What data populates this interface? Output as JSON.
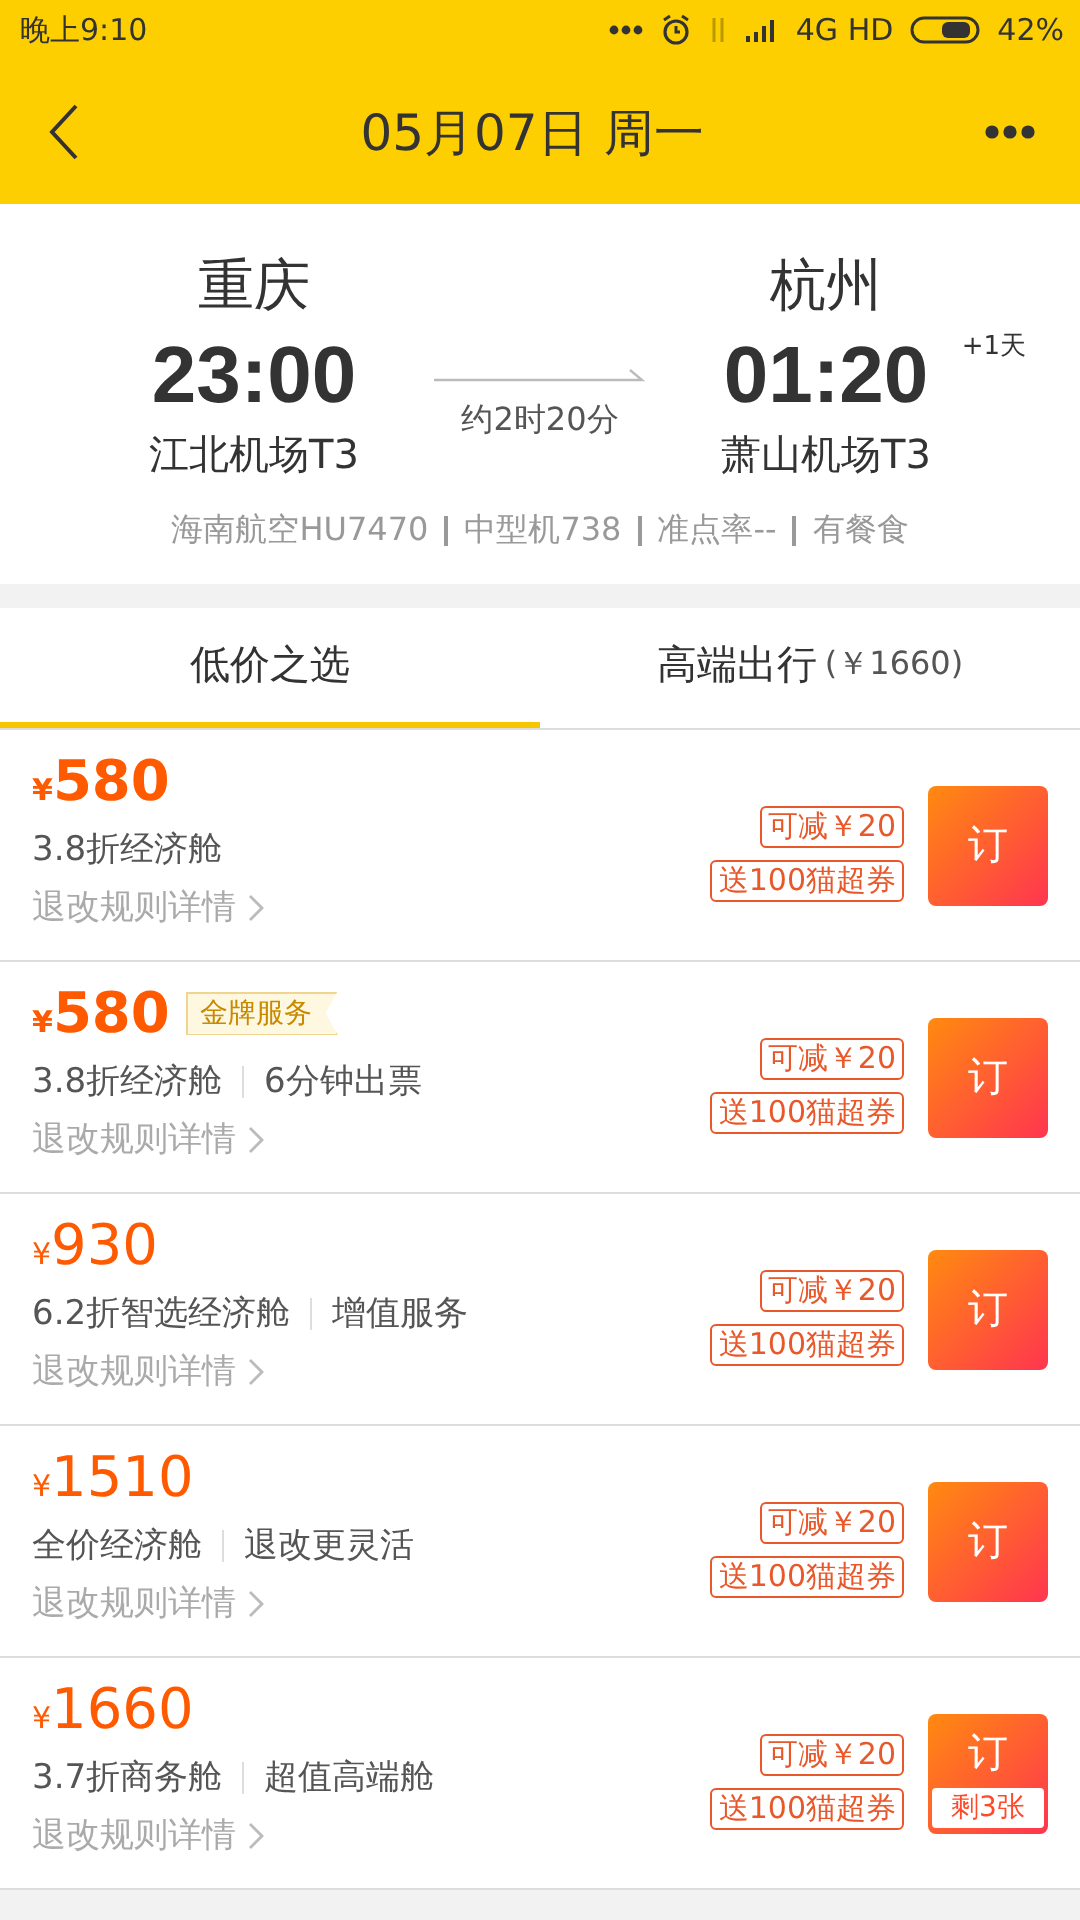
{
  "status_bar": {
    "time": "晚上9:10",
    "network": "4G HD",
    "battery": "42%"
  },
  "header": {
    "title": "05月07日 周一"
  },
  "flight": {
    "from_city": "重庆",
    "to_city": "杭州",
    "depart_time": "23:00",
    "arrive_time": "01:20",
    "next_day": "+1天",
    "depart_airport": "江北机场T3",
    "arrive_airport": "萧山机场T3",
    "duration": "约2时20分",
    "details": [
      "海南航空HU7470",
      "中型机738",
      "准点率--",
      "有餐食"
    ]
  },
  "tabs": [
    {
      "label": "低价之选",
      "selected": true
    },
    {
      "label": "高端出行",
      "note": "(￥1660)",
      "selected": false
    }
  ],
  "fares": [
    {
      "currency": "¥",
      "price": "580",
      "emphasized": true,
      "tags": [
        "3.8折经济舱"
      ],
      "rules": "退改规则详情",
      "discount": "可减￥20",
      "coupon": "送100猫超券",
      "button": "订"
    },
    {
      "currency": "¥",
      "price": "580",
      "emphasized": true,
      "badge": "金牌服务",
      "tags": [
        "3.8折经济舱",
        "6分钟出票"
      ],
      "rules": "退改规则详情",
      "discount": "可减￥20",
      "coupon": "送100猫超券",
      "button": "订"
    },
    {
      "currency": "¥",
      "price": "930",
      "emphasized": false,
      "tags": [
        "6.2折智选经济舱",
        "增值服务"
      ],
      "rules": "退改规则详情",
      "discount": "可减￥20",
      "coupon": "送100猫超券",
      "button": "订"
    },
    {
      "currency": "¥",
      "price": "1510",
      "emphasized": false,
      "tags": [
        "全价经济舱",
        "退改更灵活"
      ],
      "rules": "退改规则详情",
      "discount": "可减￥20",
      "coupon": "送100猫超券",
      "button": "订"
    },
    {
      "currency": "¥",
      "price": "1660",
      "emphasized": false,
      "tags": [
        "3.7折商务舱",
        "超值高端舱"
      ],
      "rules": "退改规则详情",
      "discount": "可减￥20",
      "coupon": "送100猫超券",
      "button": "订",
      "remaining": "剩3张"
    }
  ]
}
